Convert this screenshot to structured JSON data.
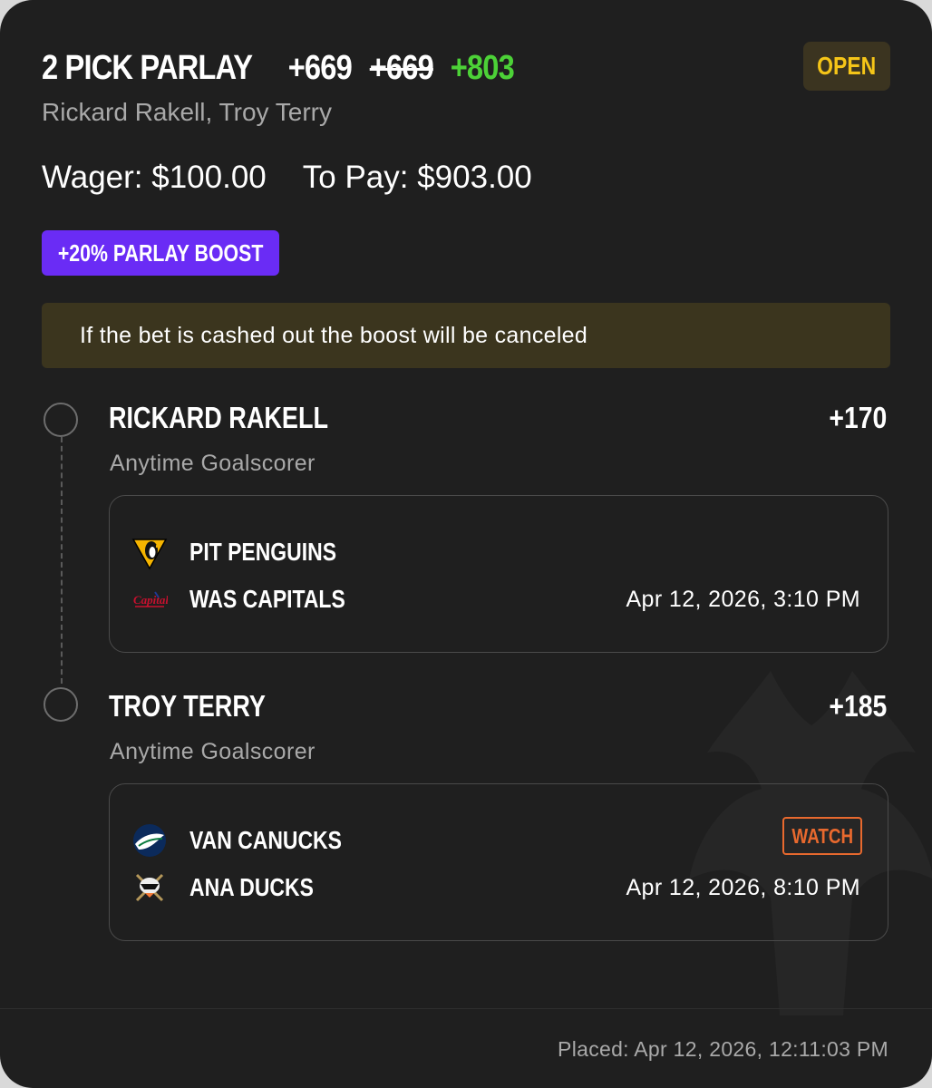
{
  "header": {
    "title": "2 PICK PARLAY",
    "original_odds": "+669",
    "struck_odds": "+669",
    "boosted_odds": "+803",
    "status": "OPEN",
    "players": "Rickard Rakell, Troy Terry"
  },
  "money": {
    "wager": "Wager: $100.00",
    "to_pay": "To Pay: $903.00"
  },
  "boost_label": "+20% PARLAY BOOST",
  "notice": "If the bet is cashed out the boost will be canceled",
  "legs": [
    {
      "player": "RICKARD RAKELL",
      "odds": "+170",
      "market": "Anytime Goalscorer",
      "team1": {
        "name": "PIT PENGUINS",
        "icon": "penguins-logo-icon"
      },
      "team2": {
        "name": "WAS CAPITALS",
        "icon": "capitals-logo-icon"
      },
      "time": "Apr 12, 2026, 3:10 PM"
    },
    {
      "player": "TROY TERRY",
      "odds": "+185",
      "market": "Anytime Goalscorer",
      "team1": {
        "name": "VAN CANUCKS",
        "icon": "canucks-logo-icon"
      },
      "team2": {
        "name": "ANA DUCKS",
        "icon": "ducks-logo-icon"
      },
      "time": "Apr 12, 2026, 8:10 PM",
      "watch_label": "WATCH"
    }
  ],
  "footer": {
    "placed": "Placed: Apr 12, 2026, 12:11:03 PM"
  },
  "colors": {
    "background": "#1f1f1f",
    "boosted_odds": "#4cd137",
    "open_badge": "#f5c518",
    "boost_badge": "#6a2cf5",
    "watch": "#e8692e"
  }
}
